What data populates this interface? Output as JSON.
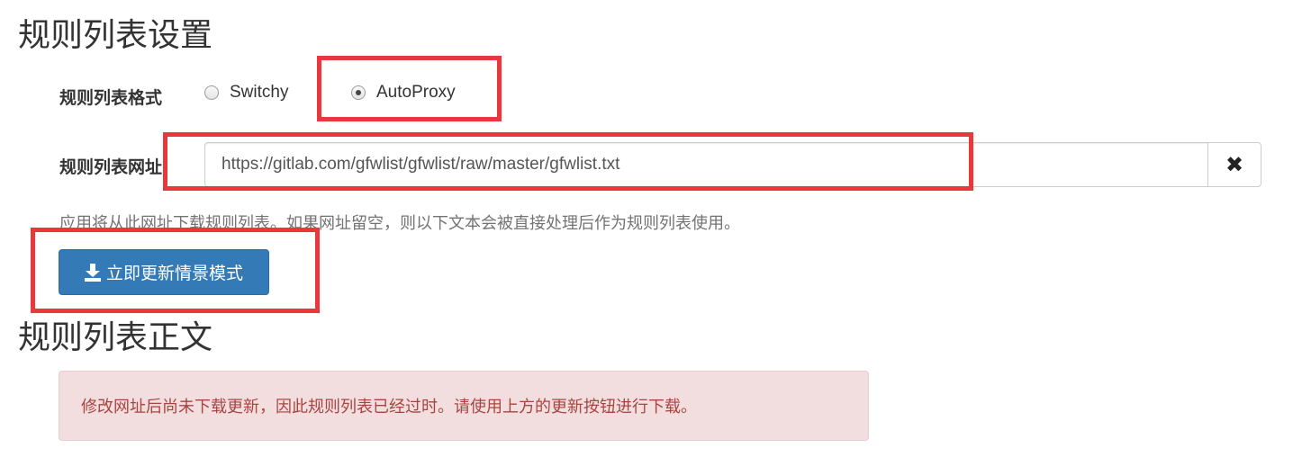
{
  "sections": {
    "settings_title": "规则列表设置",
    "content_title": "规则列表正文"
  },
  "format": {
    "label": "规则列表格式",
    "options": [
      {
        "label": "Switchy",
        "checked": false
      },
      {
        "label": "AutoProxy",
        "checked": true
      }
    ]
  },
  "url": {
    "label": "规则列表网址:",
    "value": "https://gitlab.com/gfwlist/gfwlist/raw/master/gfwlist.txt",
    "clear_icon": "✖",
    "help": "应用将从此网址下载规则列表。如果网址留空，则以下文本会被直接处理后作为规则列表使用。"
  },
  "update_button": {
    "icon": "download-icon",
    "label": "立即更新情景模式"
  },
  "alert": {
    "text": "修改网址后尚未下载更新，因此规则列表已经过时。请使用上方的更新按钮进行下载。"
  },
  "colors": {
    "highlight": "#e8373d",
    "primary": "#337ab7",
    "alert_bg": "#f2dede",
    "alert_text": "#a94442"
  }
}
